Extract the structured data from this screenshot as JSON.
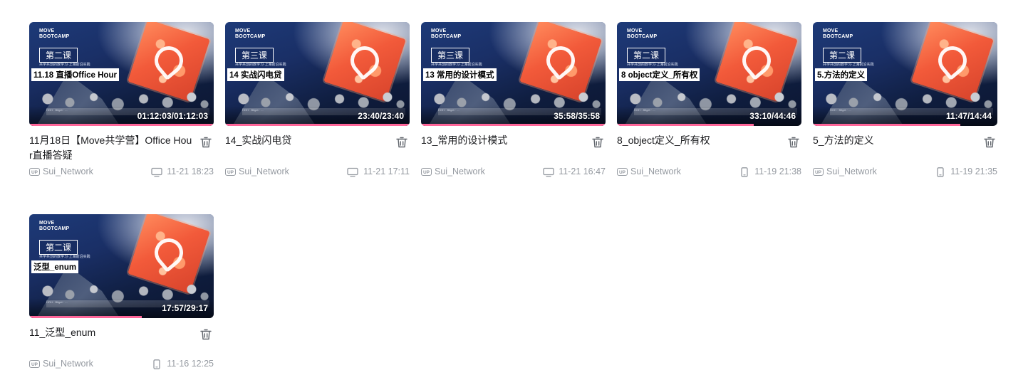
{
  "thumbnail_text": {
    "brand": "MOVE\nBOOTCAMP",
    "tagline": "共学共创的数学习·上海前沿实践",
    "sponsor": "HOH  ·  Bitget  ·  ..."
  },
  "accent_color": "#ff6699",
  "meta_color": "#9499a0",
  "videos": [
    {
      "lesson": "第二课",
      "subject": "11.18 直播Office Hour",
      "duration": "01:12:03/01:12:03",
      "progress": 1.0,
      "title": "11月18日【Move共学营】Office Hour直播答疑",
      "up_badge": "UP",
      "author": "Sui_Network",
      "device": "tv-icon",
      "time": "11-21 18:23"
    },
    {
      "lesson": "第三课",
      "subject": "14 实战闪电贷",
      "duration": "23:40/23:40",
      "progress": 1.0,
      "title": "14_实战闪电贷",
      "up_badge": "UP",
      "author": "Sui_Network",
      "device": "tv-icon",
      "time": "11-21 17:11"
    },
    {
      "lesson": "第三课",
      "subject": "13 常用的设计模式",
      "duration": "35:58/35:58",
      "progress": 1.0,
      "title": "13_常用的设计模式",
      "up_badge": "UP",
      "author": "Sui_Network",
      "device": "tv-icon",
      "time": "11-21 16:47"
    },
    {
      "lesson": "第二课",
      "subject": "8 object定义_所有权",
      "duration": "33:10/44:46",
      "progress": 0.74,
      "title": "8_object定义_所有权",
      "up_badge": "UP",
      "author": "Sui_Network",
      "device": "phone-icon",
      "time": "11-19 21:38"
    },
    {
      "lesson": "第二课",
      "subject": "5.方法的定义",
      "duration": "11:47/14:44",
      "progress": 0.8,
      "title": "5_方法的定义",
      "up_badge": "UP",
      "author": "Sui_Network",
      "device": "phone-icon",
      "time": "11-19 21:35"
    },
    {
      "lesson": "第二课",
      "subject": "泛型_enum",
      "duration": "17:57/29:17",
      "progress": 0.61,
      "title": "11_泛型_enum",
      "up_badge": "UP",
      "author": "Sui_Network",
      "device": "phone-icon",
      "time": "11-16 12:25"
    }
  ]
}
